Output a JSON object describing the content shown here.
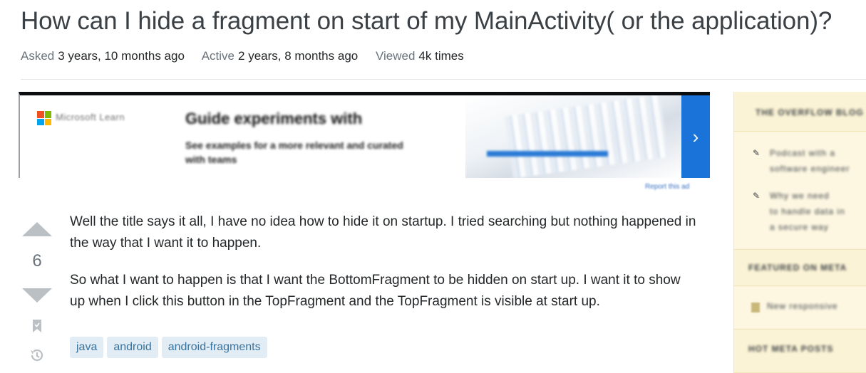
{
  "question": {
    "title": "How can I hide a fragment on start of my MainActivity( or the application)?",
    "meta": {
      "asked_label": "Asked",
      "asked_value": "3 years, 10 months ago",
      "active_label": "Active",
      "active_value": "2 years, 8 months ago",
      "viewed_label": "Viewed",
      "viewed_value": "4k times"
    },
    "votes": "6",
    "body": [
      "Well the title says it all, I have no idea how to hide it on startup. I tried searching but nothing happened in the way that I want it to happen.",
      "So what I want to happen is that I want the BottomFragment to be hidden on start up. I want it to show up when I click this button in the TopFragment and the TopFragment is visible at start up."
    ],
    "tags": [
      "java",
      "android",
      "android-fragments"
    ]
  },
  "ad": {
    "brand": "Microsoft Learn",
    "headline": "Guide experiments with",
    "subline": "See examples for a more relevant and curated",
    "subline2": "with teams",
    "report_label": "Report this ad",
    "next_glyph": "›"
  },
  "sidebar": {
    "header1": "THE OVERFLOW BLOG",
    "item1_line1": "Podcast with a",
    "item1_line2": "software engineer",
    "item2_line1": "Why we need",
    "item2_line2": "to handle data in",
    "item2_line3": "a secure way",
    "header2": "FEATURED ON META",
    "item3": "New responsive",
    "header3": "HOT META POSTS"
  },
  "colors": {
    "tag_bg": "#e1ecf4",
    "tag_text": "#39739d",
    "sidebar_bg": "#fbf3d5",
    "vote_arrow": "#bbc0c4",
    "ad_button": "#1a73d9"
  }
}
